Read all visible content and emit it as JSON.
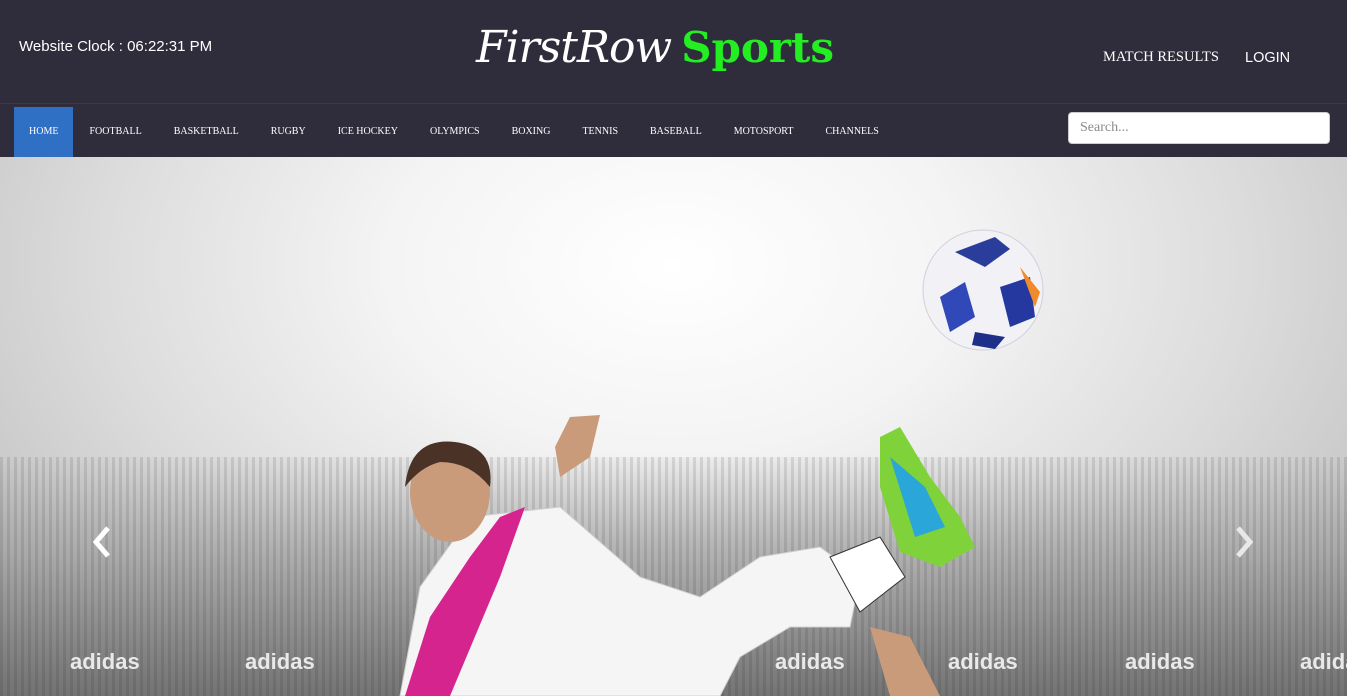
{
  "header": {
    "clock_label": "Website Clock : 06:22:31 PM",
    "logo_script": "FirstRow",
    "logo_bold": "Sports",
    "links": {
      "results": "MATCH RESULTS",
      "login": "LOGIN"
    }
  },
  "nav": {
    "items": [
      "HOME",
      "FOOTBALL",
      "BASKETBALL",
      "RUGBY",
      "ICE HOCKEY",
      "OLYMPICS",
      "BOXING",
      "TENNIS",
      "BASEBALL",
      "MOTOSPORT",
      "CHANNELS"
    ],
    "active": "HOME"
  },
  "search": {
    "placeholder": "Search..."
  },
  "hero": {
    "ad_text": [
      "adidas",
      "adidas",
      "adidas",
      "adidas",
      "adidas",
      "adidas",
      "adidas",
      "adidas"
    ]
  },
  "colors": {
    "bar": "#2f2d3c",
    "active": "#2f6fc4",
    "accent": "#22ee22"
  }
}
